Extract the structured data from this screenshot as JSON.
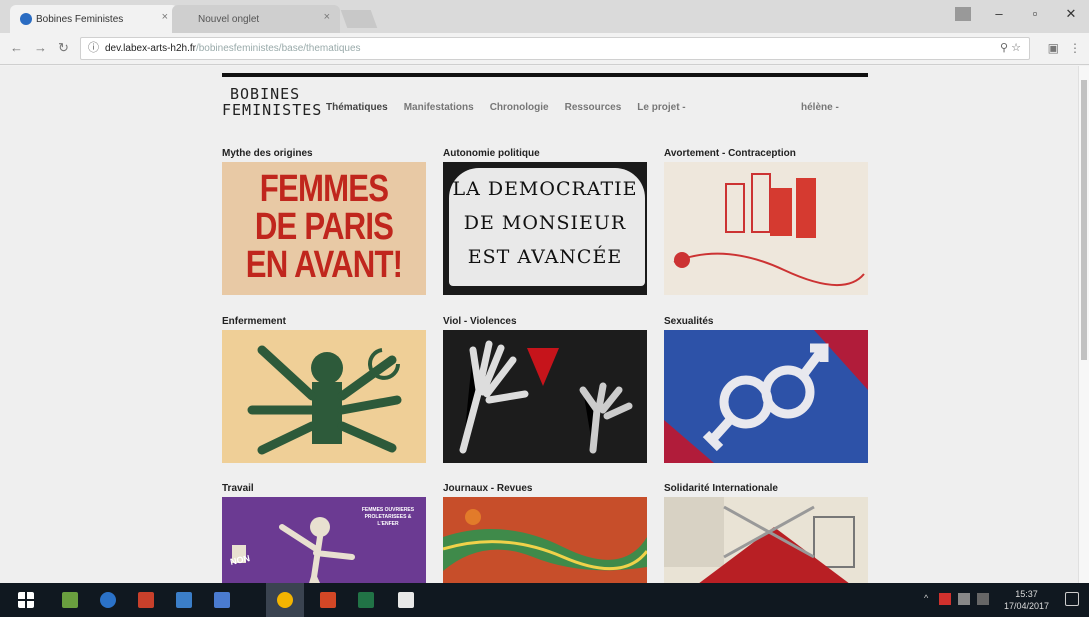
{
  "browser": {
    "tabs": [
      {
        "label": "Bobines Feministes",
        "active": true
      },
      {
        "label": "Nouvel onglet",
        "active": false
      }
    ],
    "address": {
      "host": "dev.labex-arts-h2h.fr",
      "path": "/bobinesfeministes/base/thematiques"
    }
  },
  "site": {
    "logo_line1": "BOBINES",
    "logo_line2": "FEMINISTES",
    "nav": [
      {
        "label": "Thématiques"
      },
      {
        "label": "Manifestations"
      },
      {
        "label": "Chronologie"
      },
      {
        "label": "Ressources"
      },
      {
        "label": "Le projet -"
      }
    ],
    "user": "hélène -"
  },
  "themes": [
    {
      "title": "Mythe des origines",
      "image_text": "FEMMES DE PARIS EN AVANT!"
    },
    {
      "title": "Autonomie politique",
      "image_text": "LA DEMOCRATIE DE MONSIEUR EST AVANCÉE"
    },
    {
      "title": "Avortement - Contraception"
    },
    {
      "title": "Enfermement"
    },
    {
      "title": "Viol - Violences"
    },
    {
      "title": "Sexualités"
    },
    {
      "title": "Travail",
      "image_text": "FEMMES OUVRIERES PROLETARISEES & L'ENFER",
      "image_text2": "NON"
    },
    {
      "title": "Journaux - Revues"
    },
    {
      "title": "Solidarité Internationale"
    }
  ],
  "taskbar": {
    "time": "15:37",
    "date": "17/04/2017"
  },
  "colors": {
    "accent_red": "#c0261d",
    "sexu_blue": "#2d52a8",
    "travail_purple": "#6b3a92"
  }
}
